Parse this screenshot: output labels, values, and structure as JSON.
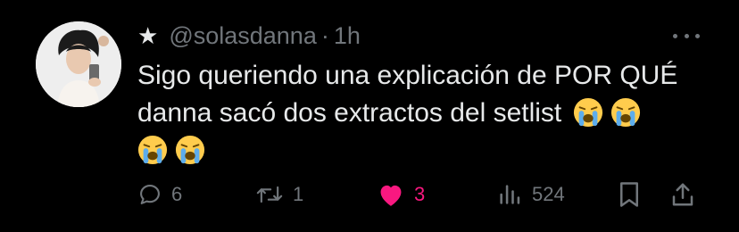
{
  "tweet": {
    "star_icon": "star-icon",
    "handle": "@solasdanna",
    "separator": "·",
    "time": "1h",
    "text_line1": "Sigo queriendo una explicación de POR QUÉ",
    "text_line2": "danna sacó dos extractos del setlist",
    "emoji": "loudly-crying-face"
  },
  "actions": {
    "replies": "6",
    "retweets": "1",
    "likes": "3",
    "views": "524"
  },
  "colors": {
    "background": "#000000",
    "text": "#e7e9ea",
    "muted": "#71767b",
    "like": "#f91880"
  }
}
